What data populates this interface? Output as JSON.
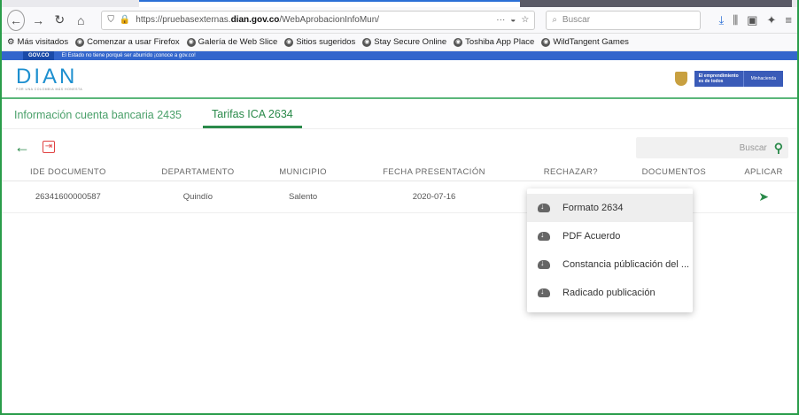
{
  "browser": {
    "url_prefix": "https://pruebasexternas.",
    "url_domain": "dian.gov.co",
    "url_path": "/WebAprobacionInfoMun/",
    "search_placeholder": "Buscar",
    "icons": [
      "back-icon",
      "forward-icon",
      "reload-icon",
      "home-icon",
      "shield-icon",
      "lock-icon",
      "more-icon",
      "pocket-icon",
      "star-icon",
      "search-icon",
      "download-icon",
      "library-icon",
      "sidebar-icon",
      "extension-icon",
      "menu-icon"
    ]
  },
  "bookmarks": [
    {
      "label": "Más visitados"
    },
    {
      "label": "Comenzar a usar Firefox"
    },
    {
      "label": "Galería de Web Slice"
    },
    {
      "label": "Sitios sugeridos"
    },
    {
      "label": "Stay Secure Online"
    },
    {
      "label": "Toshiba App Place"
    },
    {
      "label": "WildTangent Games"
    }
  ],
  "govbar": {
    "badge": "GOV.CO",
    "text": "El Estado no tiene porqué ser aburrido ¡conoce a gov.co!"
  },
  "header": {
    "logo": "DIAN",
    "logo_sub": "POR UNA COLOMBIA MÁS HONESTA",
    "brand_line1": "El emprendimiento",
    "brand_line2": "es de todos",
    "brand2": "Minhacienda"
  },
  "tabs": [
    {
      "label": "Información cuenta bancaria 2435",
      "active": false
    },
    {
      "label": "Tarifas ICA 2634",
      "active": true
    }
  ],
  "actions": {
    "back_glyph": "←",
    "logout_glyph": "⇥",
    "search_placeholder": "Buscar",
    "search_glyph": "🔍"
  },
  "table": {
    "columns": [
      "IDE DOCUMENTO",
      "DEPARTAMENTO",
      "MUNICIPIO",
      "FECHA PRESENTACIÓN",
      "RECHAZAR?",
      "DOCUMENTOS",
      "APLICAR"
    ],
    "rows": [
      {
        "ide": "26341600000587",
        "departamento": "Quindío",
        "municipio": "Salento",
        "fecha": "2020-07-16",
        "aplicar_glyph": "➤"
      }
    ]
  },
  "menu": {
    "items": [
      {
        "label": "Formato 2634",
        "icon": "cloud-download-icon"
      },
      {
        "label": "PDF Acuerdo",
        "icon": "cloud-download-icon"
      },
      {
        "label": "Constancia públicación del ...",
        "icon": "cloud-download-icon"
      },
      {
        "label": "Radicado publicación",
        "icon": "cloud-download-icon"
      }
    ]
  },
  "colors": {
    "accent": "#2a8a4a",
    "logo": "#1d8fcf",
    "govbar": "#3366cc",
    "danger": "#e04040"
  }
}
